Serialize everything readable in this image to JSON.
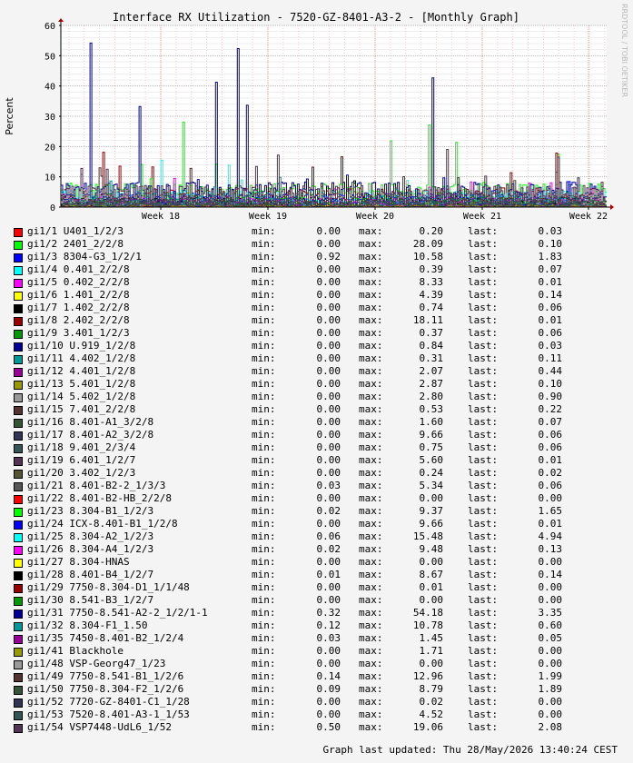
{
  "chart_data": {
    "type": "line",
    "title": "Interface RX Utilization - 7520-GZ-8401-A3-2 - [Monthly Graph]",
    "ylabel": "Percent",
    "ylim": [
      0,
      60
    ],
    "yticks": [
      "0",
      "10",
      "20",
      "30",
      "40",
      "50",
      "60"
    ],
    "xticks": [
      "Week 18",
      "Week 19",
      "Week 20",
      "Week 21",
      "Week 22"
    ],
    "grid": true,
    "watermark": "RRDTOOL / TOBI OETIKER",
    "series": [
      {
        "name": "gi1/1 U401_1/2/3",
        "color": "#FF0000",
        "min": "0.00",
        "max": "0.20",
        "last": "0.03"
      },
      {
        "name": "gi1/2 2401_2/2/8",
        "color": "#00FF00",
        "min": "0.00",
        "max": "28.09",
        "last": "0.10"
      },
      {
        "name": "gi1/3 8304-G3_1/2/1",
        "color": "#0000FF",
        "min": "0.92",
        "max": "10.58",
        "last": "1.83"
      },
      {
        "name": "gi1/4 0.401_2/2/8",
        "color": "#00FFFF",
        "min": "0.00",
        "max": "0.39",
        "last": "0.07"
      },
      {
        "name": "gi1/5 0.402_2/2/8",
        "color": "#FF00FF",
        "min": "0.00",
        "max": "8.33",
        "last": "0.01"
      },
      {
        "name": "gi1/6 1.401_2/2/8",
        "color": "#FFFF00",
        "min": "0.00",
        "max": "4.39",
        "last": "0.14"
      },
      {
        "name": "gi1/7 1.402_2/2/8",
        "color": "#000000",
        "min": "0.00",
        "max": "0.74",
        "last": "0.06"
      },
      {
        "name": "gi1/8 2.402_2/2/8",
        "color": "#990000",
        "min": "0.00",
        "max": "18.11",
        "last": "0.01"
      },
      {
        "name": "gi1/9 3.401_1/2/3",
        "color": "#009900",
        "min": "0.00",
        "max": "0.37",
        "last": "0.06"
      },
      {
        "name": "gi1/10 U.919_1/2/8",
        "color": "#000099",
        "min": "0.00",
        "max": "0.84",
        "last": "0.03"
      },
      {
        "name": "gi1/11 4.402_1/2/8",
        "color": "#009999",
        "min": "0.00",
        "max": "0.31",
        "last": "0.11"
      },
      {
        "name": "gi1/12 4.401_1/2/8",
        "color": "#990099",
        "min": "0.00",
        "max": "2.07",
        "last": "0.44"
      },
      {
        "name": "gi1/13 5.401_1/2/8",
        "color": "#999900",
        "min": "0.00",
        "max": "2.87",
        "last": "0.10"
      },
      {
        "name": "gi1/14 5.402_1/2/8",
        "color": "#999999",
        "min": "0.00",
        "max": "2.80",
        "last": "0.90"
      },
      {
        "name": "gi1/15 7.401_2/2/8",
        "color": "#553333",
        "min": "0.00",
        "max": "0.53",
        "last": "0.22"
      },
      {
        "name": "gi1/16 8.401-A1_3/2/8",
        "color": "#335533",
        "min": "0.00",
        "max": "1.60",
        "last": "0.07"
      },
      {
        "name": "gi1/17 8.401-A2_3/2/8",
        "color": "#333355",
        "min": "0.00",
        "max": "9.66",
        "last": "0.06"
      },
      {
        "name": "gi1/18 9.401_2/3/4",
        "color": "#335555",
        "min": "0.00",
        "max": "0.75",
        "last": "0.06"
      },
      {
        "name": "gi1/19 6.401_1/2/7",
        "color": "#553355",
        "min": "0.00",
        "max": "5.60",
        "last": "0.01"
      },
      {
        "name": "gi1/20 3.402_1/2/3",
        "color": "#555533",
        "min": "0.00",
        "max": "0.24",
        "last": "0.02"
      },
      {
        "name": "gi1/21 8.401-B2-2_1/3/3",
        "color": "#555555",
        "min": "0.03",
        "max": "5.34",
        "last": "0.06"
      },
      {
        "name": "gi1/22 8.401-B2-HB_2/2/8",
        "color": "#FF0000",
        "min": "0.00",
        "max": "0.00",
        "last": "0.00"
      },
      {
        "name": "gi1/23 8.304-B1_1/2/3",
        "color": "#00FF00",
        "min": "0.02",
        "max": "9.37",
        "last": "1.65"
      },
      {
        "name": "gi1/24 ICX-8.401-B1_1/2/8",
        "color": "#0000FF",
        "min": "0.00",
        "max": "9.66",
        "last": "0.01"
      },
      {
        "name": "gi1/25 8.304-A2_1/2/3",
        "color": "#00FFFF",
        "min": "0.06",
        "max": "15.48",
        "last": "4.94"
      },
      {
        "name": "gi1/26 8.304-A4_1/2/3",
        "color": "#FF00FF",
        "min": "0.02",
        "max": "9.48",
        "last": "0.13"
      },
      {
        "name": "gi1/27 8.304-HNAS",
        "color": "#FFFF00",
        "min": "0.00",
        "max": "0.00",
        "last": "0.00"
      },
      {
        "name": "gi1/28 8.401-B4_1/2/7",
        "color": "#000000",
        "min": "0.01",
        "max": "8.67",
        "last": "0.14"
      },
      {
        "name": "gi1/29 7750-8.304-D1_1/1/48",
        "color": "#990000",
        "min": "0.00",
        "max": "0.01",
        "last": "0.00"
      },
      {
        "name": "gi1/30 8.541-B3_1/2/7",
        "color": "#009900",
        "min": "0.00",
        "max": "0.00",
        "last": "0.00"
      },
      {
        "name": "gi1/31 7750-8.541-A2-2_1/2/1-1",
        "color": "#000099",
        "min": "0.32",
        "max": "54.18",
        "last": "3.35"
      },
      {
        "name": "gi1/32 8.304-F1_1.50",
        "color": "#009999",
        "min": "0.12",
        "max": "10.78",
        "last": "0.60"
      },
      {
        "name": "gi1/35 7450-8.401-B2_1/2/4",
        "color": "#990099",
        "min": "0.03",
        "max": "1.45",
        "last": "0.05"
      },
      {
        "name": "gi1/41 Blackhole",
        "color": "#999900",
        "min": "0.00",
        "max": "1.71",
        "last": "0.00"
      },
      {
        "name": "gi1/48 VSP-Georg47_1/23",
        "color": "#999999",
        "min": "0.00",
        "max": "0.00",
        "last": "0.00"
      },
      {
        "name": "gi1/49 7750-8.541-B1_1/2/6",
        "color": "#553333",
        "min": "0.14",
        "max": "12.96",
        "last": "1.99"
      },
      {
        "name": "gi1/50 7750-8.304-F2_1/2/6",
        "color": "#335533",
        "min": "0.09",
        "max": "8.79",
        "last": "1.89"
      },
      {
        "name": "gi1/52 7720-GZ-8401-C1_1/28",
        "color": "#333355",
        "min": "0.00",
        "max": "0.02",
        "last": "0.00"
      },
      {
        "name": "gi1/53 7520-8.401-A3-1_1/53",
        "color": "#335555",
        "min": "0.00",
        "max": "4.52",
        "last": "0.00"
      },
      {
        "name": "gi1/54 VSP7448-UdL6_1/52",
        "color": "#553355",
        "min": "0.50",
        "max": "19.06",
        "last": "2.08"
      }
    ]
  },
  "legend_labels": {
    "min": "min:",
    "max": "max:",
    "last": "last:"
  },
  "footer": "Graph last updated: Thu 28/May/2026 13:40:24 CEST"
}
